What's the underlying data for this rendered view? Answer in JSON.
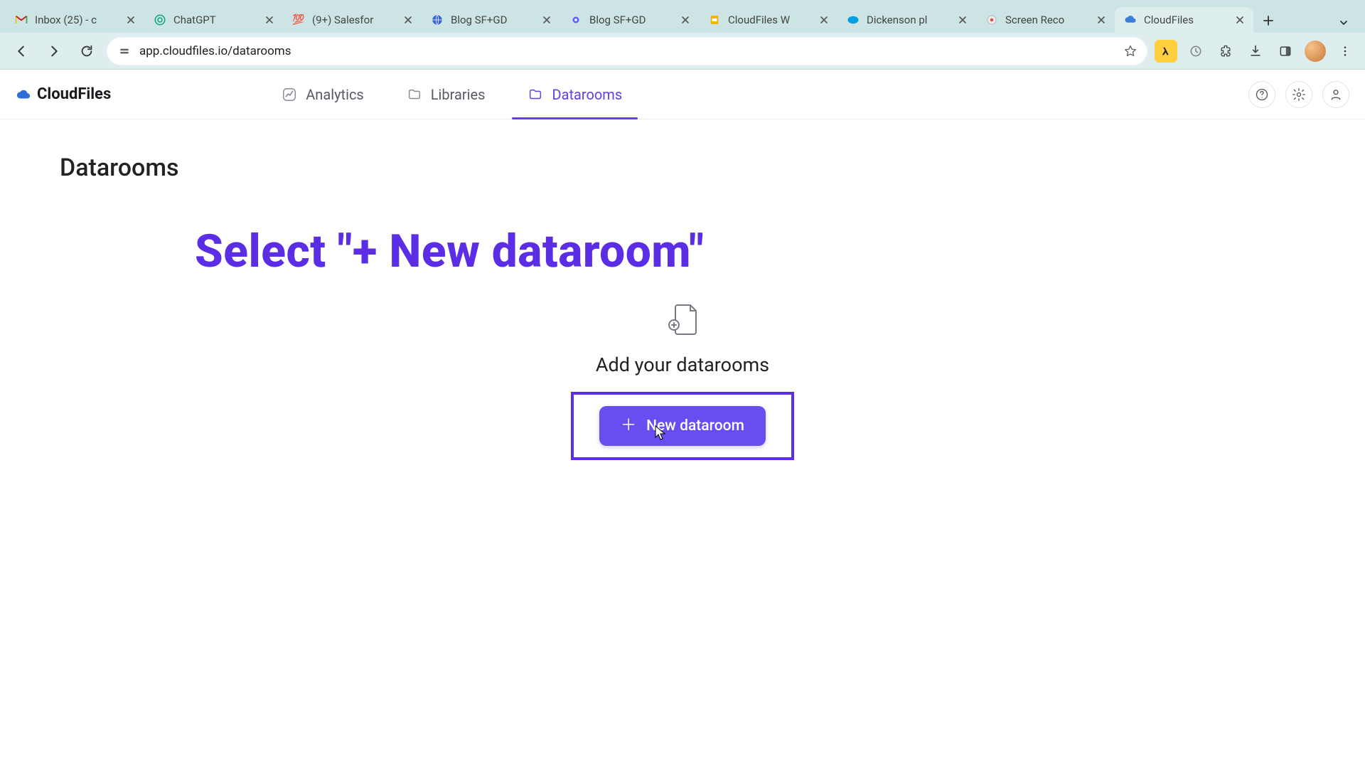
{
  "browser": {
    "tabs": [
      {
        "label": "Inbox (25) - c"
      },
      {
        "label": "ChatGPT"
      },
      {
        "label": "(9+) Salesfor"
      },
      {
        "label": "Blog SF+GD"
      },
      {
        "label": "Blog SF+GD"
      },
      {
        "label": "CloudFiles W"
      },
      {
        "label": "Dickenson pl"
      },
      {
        "label": "Screen Reco"
      },
      {
        "label": "CloudFiles"
      }
    ],
    "url": "app.cloudfiles.io/datarooms"
  },
  "app": {
    "brand": "CloudFiles",
    "nav": {
      "analytics": "Analytics",
      "libraries": "Libraries",
      "datarooms": "Datarooms"
    }
  },
  "page": {
    "title": "Datarooms",
    "instruction": "Select \"+ New dataroom\"",
    "empty_heading": "Add your datarooms",
    "new_button": "New dataroom"
  }
}
